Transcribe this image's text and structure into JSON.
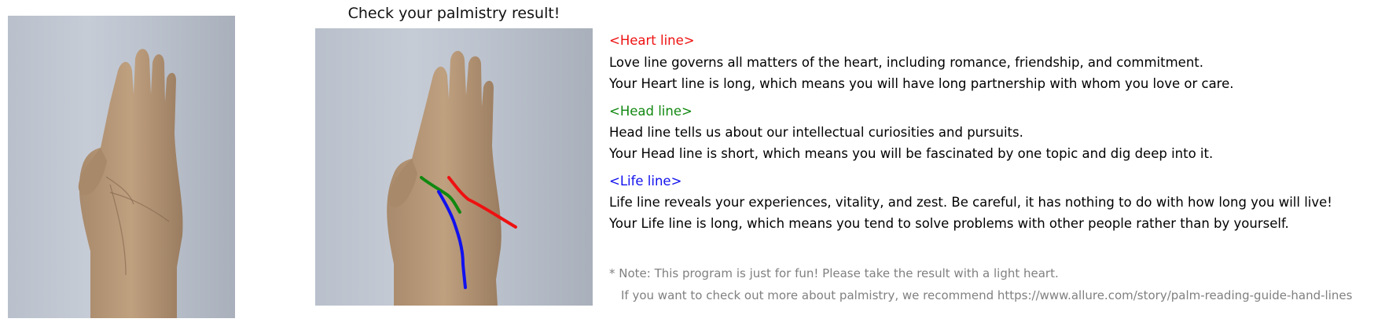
{
  "title": "Check your palmistry result!",
  "colors": {
    "heart": "#ee1111",
    "head": "#118811",
    "life": "#1111ee",
    "note": "#808080"
  },
  "sections": {
    "heart": {
      "header": "<Heart line>",
      "desc": "Love line governs all matters of the heart, including romance, friendship, and commitment.",
      "result": "Your Heart line is long, which means you will have long partnership with whom you love or care."
    },
    "head": {
      "header": "<Head line>",
      "desc": "Head line tells us about our intellectual curiosities and pursuits.",
      "result": "Your Head line is short, which means you will be fascinated by one topic and dig deep into it."
    },
    "life": {
      "header": "<Life line>",
      "desc": "Life line reveals your experiences, vitality, and zest. Be careful, it has nothing to do with how long you will live!",
      "result": "Your Life line is long, which means you tend to solve problems with other people rather than by yourself."
    }
  },
  "note": {
    "line1": "* Note: This program is just for fun! Please take the result with a light heart.",
    "line2": "If you want to check out more about palmistry, we recommend https://www.allure.com/story/palm-reading-guide-hand-lines"
  }
}
